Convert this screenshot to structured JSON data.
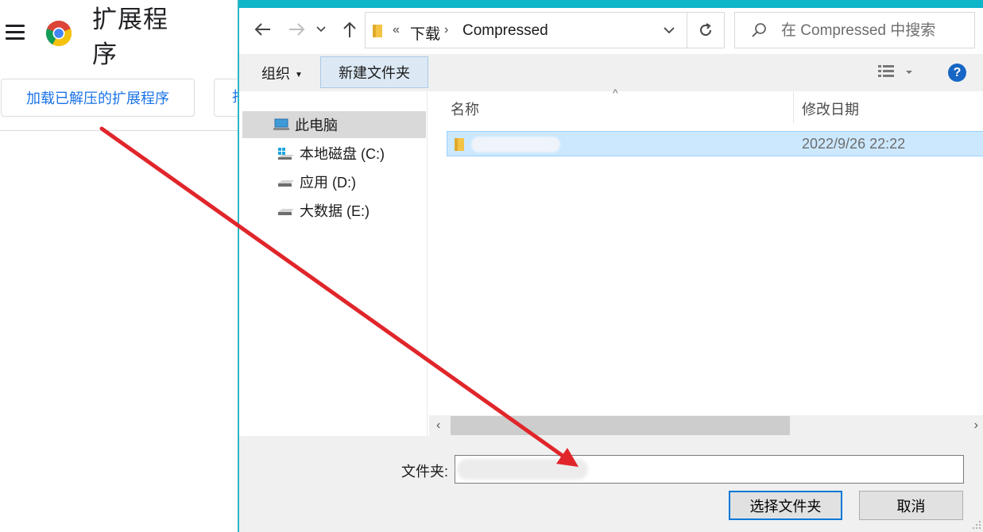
{
  "extensions_page": {
    "title": "扩展程序",
    "load_unpacked_label": "加载已解压的扩展程序",
    "second_button_label": "打"
  },
  "dialog": {
    "address": {
      "overflow": "«",
      "crumbs": [
        "下载",
        "Compressed"
      ]
    },
    "search_placeholder": "在 Compressed 中搜索",
    "toolbar": {
      "organize_label": "组织",
      "new_folder_label": "新建文件夹",
      "help_label": "?"
    },
    "nav_tree": [
      {
        "label": "此电脑",
        "icon": "computer-icon",
        "selected": true
      },
      {
        "label": "本地磁盘 (C:)",
        "icon": "windows-drive-icon",
        "selected": false
      },
      {
        "label": "应用 (D:)",
        "icon": "drive-icon",
        "selected": false
      },
      {
        "label": "大数据 (E:)",
        "icon": "drive-icon",
        "selected": false
      }
    ],
    "columns": {
      "name": "名称",
      "modified": "修改日期"
    },
    "files": [
      {
        "name": "",
        "modified": "2022/9/26 22:22",
        "selected": true
      }
    ],
    "folder_label": "文件夹:",
    "folder_value": "",
    "select_button": "选择文件夹",
    "cancel_button": "取消"
  },
  "colors": {
    "chrome_blue": "#1a73e8",
    "dialog_accent": "#0fb5c8",
    "selection": "#cce8ff",
    "annotation_arrow": "#e0262b"
  }
}
